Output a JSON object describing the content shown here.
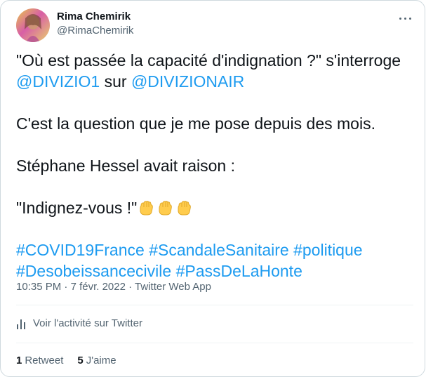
{
  "author": {
    "display_name": "Rima Chemirik",
    "handle": "@RimaChemirik"
  },
  "tweet": {
    "line1": "\"Où est passée la capacité d'indignation ?\" s'interroge",
    "mention1": "@DIVIZIO1",
    "between": " sur ",
    "mention2": "@DIVIZIONAIR",
    "para2": "C'est la question que je me pose depuis des mois.",
    "para3": "Stéphane Hessel avait raison :",
    "para4": "\"Indignez-vous !\"",
    "emoji_icons": [
      "raised-fist-icon",
      "raised-fist-icon",
      "raised-fist-icon"
    ],
    "hashtags": [
      "#COVID19France",
      "#ScandaleSanitaire",
      "#politique",
      "#Desobeissancecivile",
      "#PassDeLaHonte"
    ]
  },
  "meta": {
    "time": "10:35 PM",
    "separator": " · ",
    "date": "7 févr. 2022",
    "source": "Twitter Web App"
  },
  "activity": {
    "label": "Voir l'activité sur Twitter",
    "icon": "analytics-icon"
  },
  "stats": {
    "retweets_count": "1",
    "retweets_label": "Retweet",
    "likes_count": "5",
    "likes_label": "J'aime"
  },
  "colors": {
    "link": "#1d9bf0",
    "secondary_text": "#536471",
    "primary_text": "#0f1419",
    "border": "#cfd9de",
    "emoji": "#ffcc4d"
  }
}
